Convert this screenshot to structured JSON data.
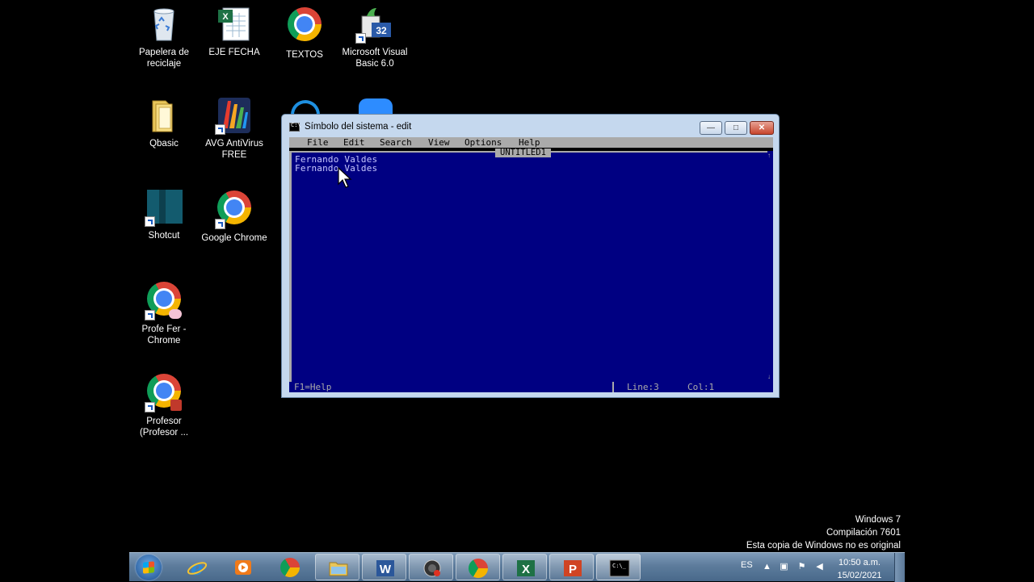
{
  "desktop": {
    "icons": [
      {
        "label": "Papelera de reciclaje",
        "icon": "recycle-bin-icon"
      },
      {
        "label": "EJE FECHA",
        "icon": "excel-file-icon"
      },
      {
        "label": "TEXTOS",
        "icon": "chrome-icon"
      },
      {
        "label": "Microsoft Visual Basic 6.0",
        "icon": "visual-basic-icon"
      },
      {
        "label": "Qbasic",
        "icon": "folder-icon"
      },
      {
        "label": "AVG AntiVirus FREE",
        "icon": "avg-icon"
      },
      {
        "label": "Shotcut",
        "icon": "shotcut-icon"
      },
      {
        "label": "Google Chrome",
        "icon": "chrome-icon"
      },
      {
        "label": "Profe Fer - Chrome",
        "icon": "chrome-profile-icon"
      },
      {
        "label": "Profesor (Profesor ...",
        "icon": "chrome-profile-icon"
      }
    ]
  },
  "window": {
    "title": "Símbolo del sistema - edit",
    "controls": {
      "minimize": "—",
      "maximize": "□",
      "close": "✕"
    }
  },
  "editor": {
    "menu": [
      "File",
      "Edit",
      "Search",
      "View",
      "Options",
      "Help"
    ],
    "document_title": "UNTITLED1",
    "lines": [
      "Fernando Valdes",
      "Fernando Valdes"
    ],
    "status_help": "F1=Help",
    "status_line": "Line:3",
    "status_col": "Col:1",
    "scroll_up": "↑",
    "scroll_down": "↓"
  },
  "watermark": {
    "line1": "Windows 7",
    "line2": "Compilación  7601",
    "line3": "Esta copia de Windows no es original"
  },
  "taskbar": {
    "items": [
      "internet-explorer-icon",
      "media-player-icon",
      "chrome-icon",
      "explorer-icon",
      "word-icon",
      "obs-icon",
      "chrome-profile-icon",
      "excel-icon",
      "powerpoint-icon",
      "cmd-icon"
    ],
    "language": "ES",
    "time": "10:50 a.m.",
    "date": "15/02/2021"
  },
  "colors": {
    "edit_background": "#000082",
    "edit_text": "#c8c8ff",
    "menu_background": "#aaaaaa",
    "window_frame": "#c5d8ee"
  }
}
